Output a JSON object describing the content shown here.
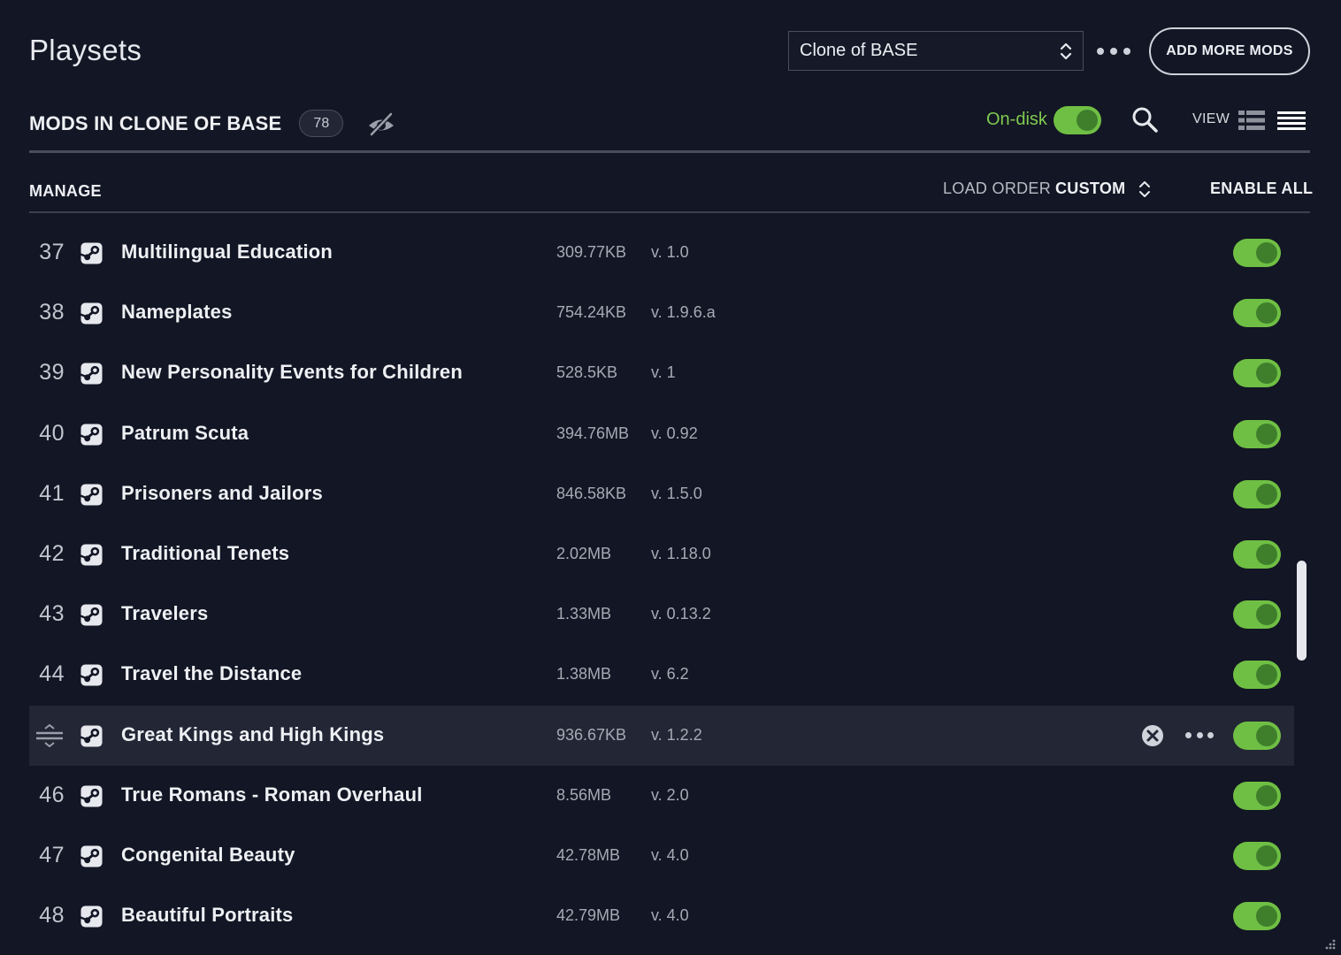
{
  "header": {
    "title": "Playsets",
    "playset_selected": "Clone of BASE",
    "add_mods_label": "ADD MORE MODS"
  },
  "mods_bar": {
    "title": "MODS IN CLONE OF BASE",
    "count": "78",
    "on_disk_label": "On-disk",
    "on_disk_enabled": true,
    "view_label": "VIEW"
  },
  "manage_bar": {
    "manage_label": "MANAGE",
    "load_order_label": "LOAD ORDER",
    "load_order_value": "CUSTOM",
    "enable_all_label": "ENABLE ALL"
  },
  "mods": [
    {
      "index": "37",
      "name": "Multilingual Education",
      "size": "309.77KB",
      "version": "v. 1.0",
      "enabled": true
    },
    {
      "index": "38",
      "name": "Nameplates",
      "size": "754.24KB",
      "version": "v. 1.9.6.a",
      "enabled": true
    },
    {
      "index": "39",
      "name": "New Personality Events for Children",
      "size": "528.5KB",
      "version": "v. 1",
      "enabled": true
    },
    {
      "index": "40",
      "name": "Patrum Scuta",
      "size": "394.76MB",
      "version": "v. 0.92",
      "enabled": true
    },
    {
      "index": "41",
      "name": "Prisoners and Jailors",
      "size": "846.58KB",
      "version": "v. 1.5.0",
      "enabled": true
    },
    {
      "index": "42",
      "name": "Traditional Tenets",
      "size": "2.02MB",
      "version": "v. 1.18.0",
      "enabled": true
    },
    {
      "index": "43",
      "name": "Travelers",
      "size": "1.33MB",
      "version": "v. 0.13.2",
      "enabled": true
    },
    {
      "index": "44",
      "name": "Travel the Distance",
      "size": "1.38MB",
      "version": "v. 6.2",
      "enabled": true
    },
    {
      "index": "45",
      "name": "Great Kings and High Kings",
      "size": "936.67KB",
      "version": "v. 1.2.2",
      "enabled": true,
      "hovered": true
    },
    {
      "index": "46",
      "name": "True Romans - Roman Overhaul",
      "size": "8.56MB",
      "version": "v. 2.0",
      "enabled": true
    },
    {
      "index": "47",
      "name": "Congenital Beauty",
      "size": "42.78MB",
      "version": "v. 4.0",
      "enabled": true
    },
    {
      "index": "48",
      "name": "Beautiful Portraits",
      "size": "42.79MB",
      "version": "v. 4.0",
      "enabled": true
    }
  ],
  "colors": {
    "background": "#131624",
    "accent_green": "#6fbf44",
    "hover_row": "#232635"
  },
  "icons": [
    "chevron-updown-icon",
    "more-dots-icon",
    "eye-off-icon",
    "search-icon",
    "grid-view-icon",
    "list-view-icon",
    "steam-icon",
    "drag-handle-icon",
    "remove-icon"
  ]
}
